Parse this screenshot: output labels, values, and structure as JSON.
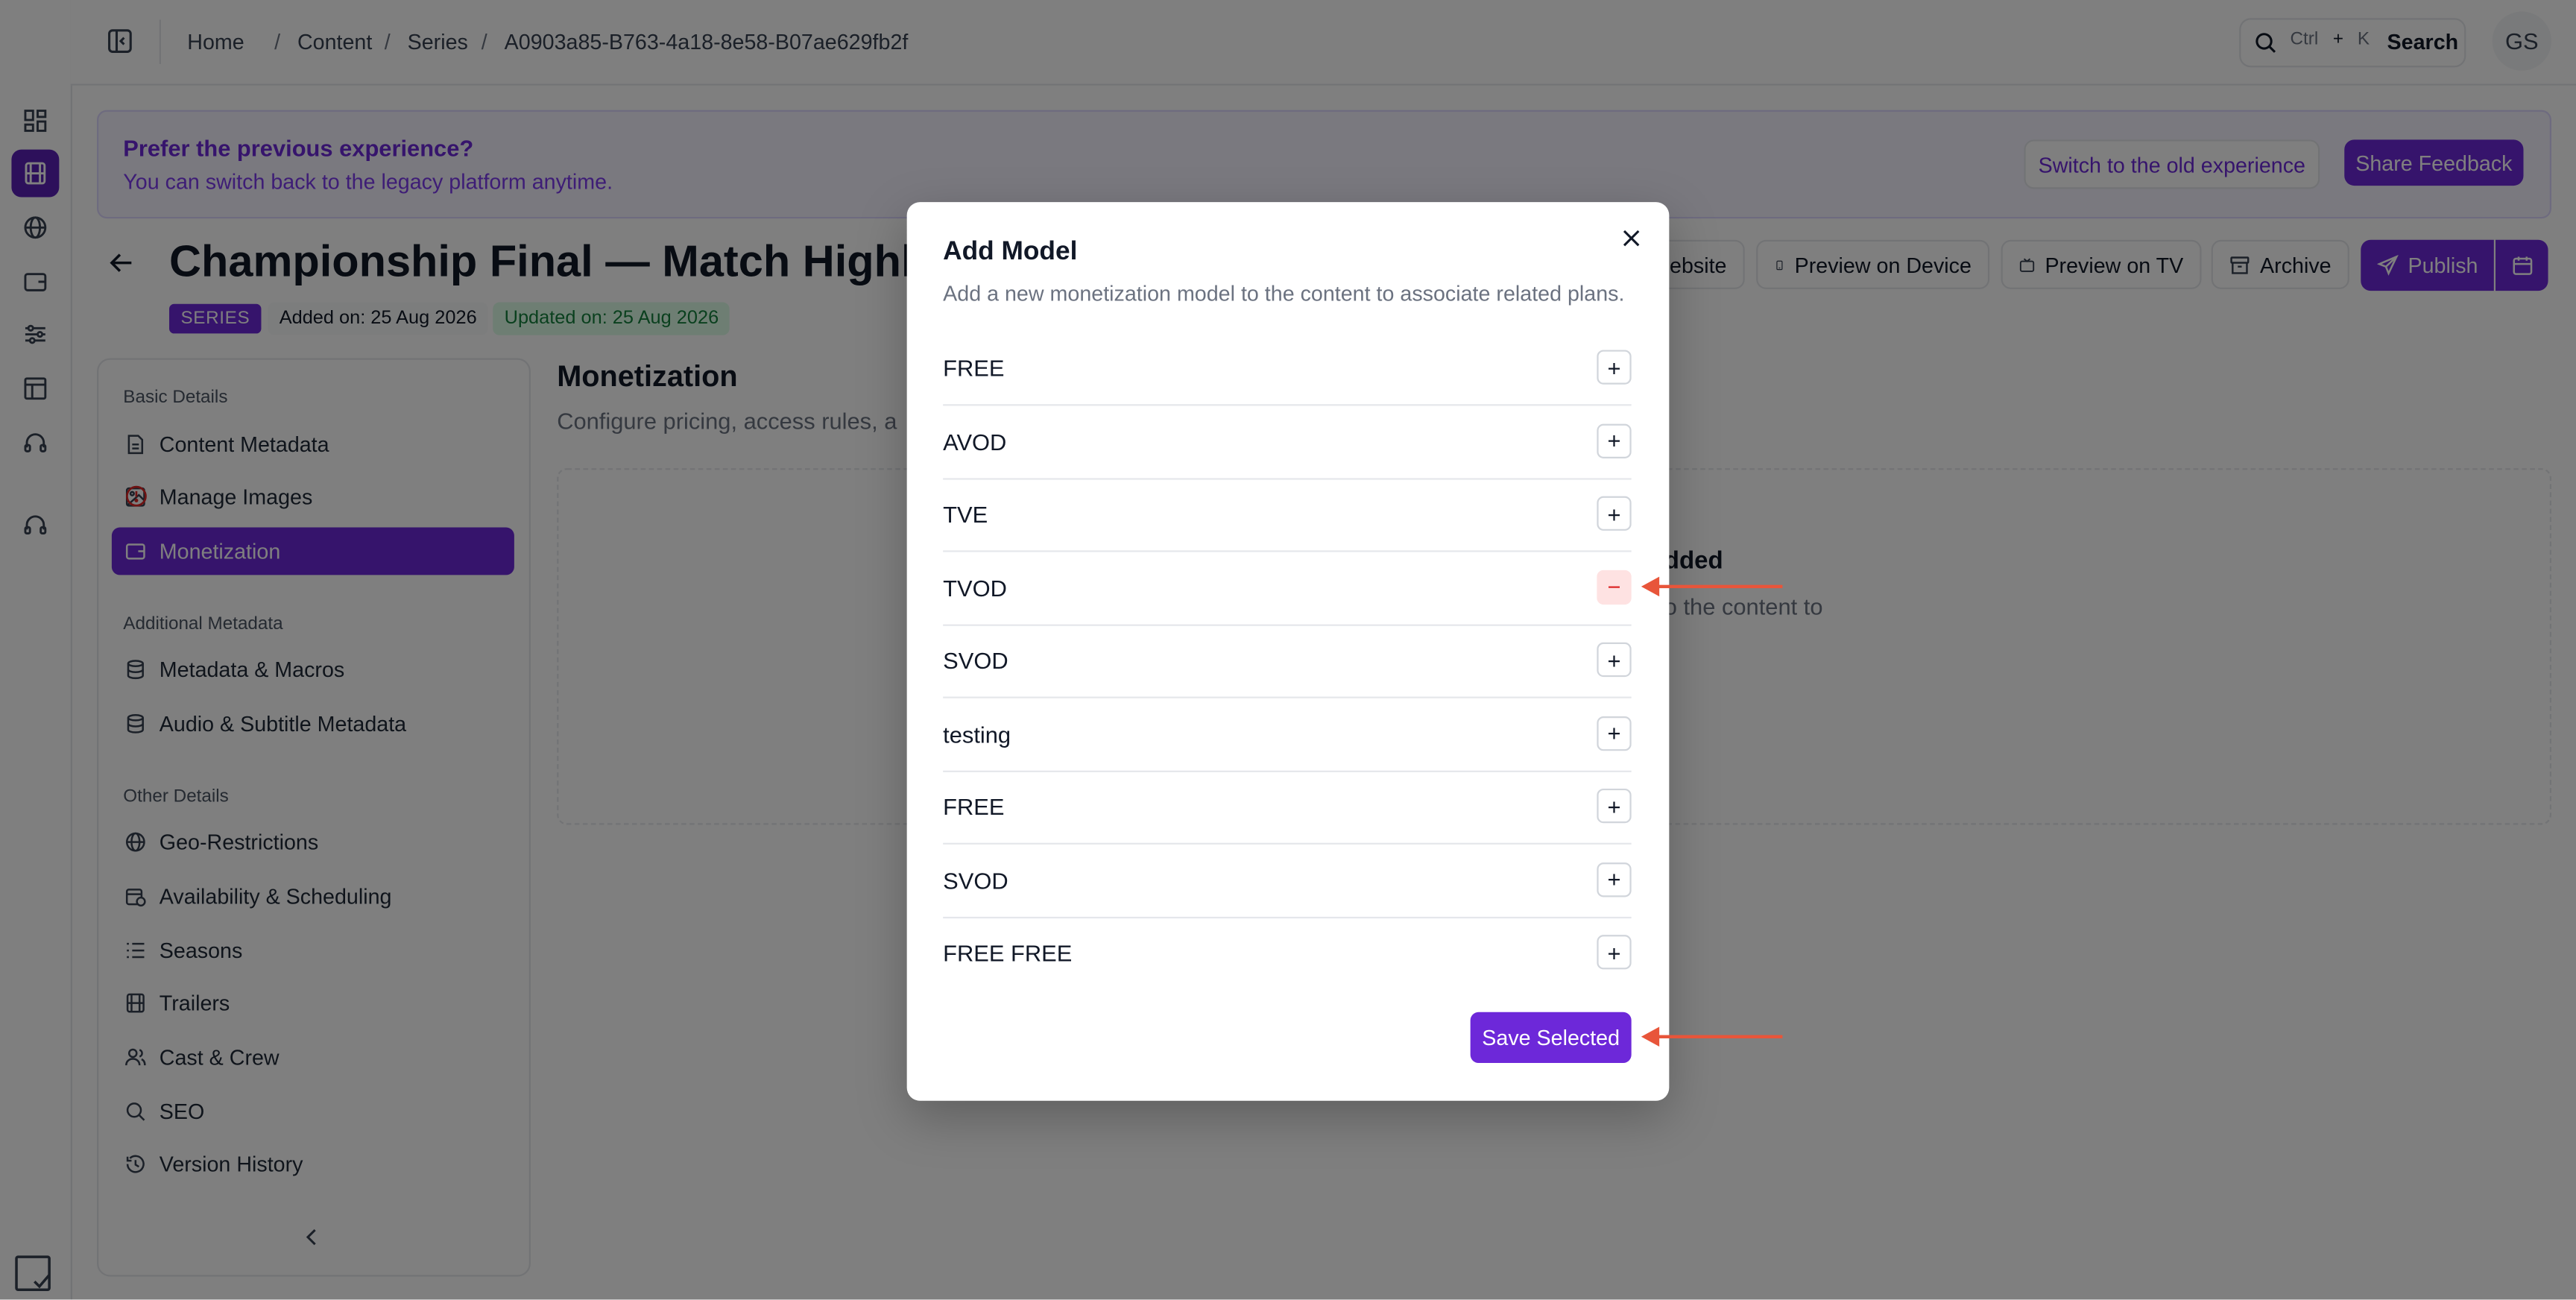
{
  "breadcrumbs": [
    "Home",
    "Content",
    "Series",
    "A0903a85-B763-4a18-8e58-B07ae629fb2f"
  ],
  "search": {
    "kbd_ctrl": "Ctrl",
    "kbd_plus": "+",
    "kbd_k": "K",
    "label": "Search"
  },
  "user": {
    "initials": "GS"
  },
  "banner": {
    "title": "Prefer the previous experience?",
    "subtitle": "You can switch back to the legacy platform anytime.",
    "switch_label": "Switch to the old experience",
    "feedback_label": "Share Feedback"
  },
  "header": {
    "title": "Championship Final — Match Highlig",
    "badge": "SERIES",
    "added": "Added on: 25 Aug 2026",
    "updated": "Updated on: 25 Aug 2026",
    "actions": {
      "website": "ebsite",
      "preview_device": "Preview on Device",
      "preview_tv": "Preview on TV",
      "archive": "Archive",
      "publish": "Publish"
    }
  },
  "sidebar": {
    "sections": [
      "Basic Details",
      "Additional Metadata",
      "Other Details"
    ],
    "basic": [
      "Content Metadata",
      "Manage Images",
      "Monetization"
    ],
    "additional": [
      "Metadata & Macros",
      "Audio & Subtitle Metadata"
    ],
    "other": [
      "Geo-Restrictions",
      "Availability & Scheduling",
      "Seasons",
      "Trailers",
      "Cast & Crew",
      "SEO",
      "Version History"
    ]
  },
  "content": {
    "title": "Monetization",
    "subtitle": "Configure pricing, access rules, a",
    "empty_title": "dded",
    "empty_text": "o the content to",
    "empty_text2": "."
  },
  "modal": {
    "title": "Add Model",
    "description": "Add a new monetization model to the content to associate related plans.",
    "models": [
      {
        "name": "FREE",
        "selected": false
      },
      {
        "name": "AVOD",
        "selected": false
      },
      {
        "name": "TVE",
        "selected": false
      },
      {
        "name": "TVOD",
        "selected": true
      },
      {
        "name": "SVOD",
        "selected": false
      },
      {
        "name": "testing",
        "selected": false
      },
      {
        "name": "FREE",
        "selected": false
      },
      {
        "name": "SVOD",
        "selected": false
      },
      {
        "name": "FREE FREE",
        "selected": false
      }
    ],
    "add_symbol": "+",
    "remove_symbol": "−",
    "save_label": "Save Selected"
  },
  "colors": {
    "accent": "#6d28d9",
    "annotation_arrow": "#e8553a",
    "remove": "#dc2626"
  }
}
